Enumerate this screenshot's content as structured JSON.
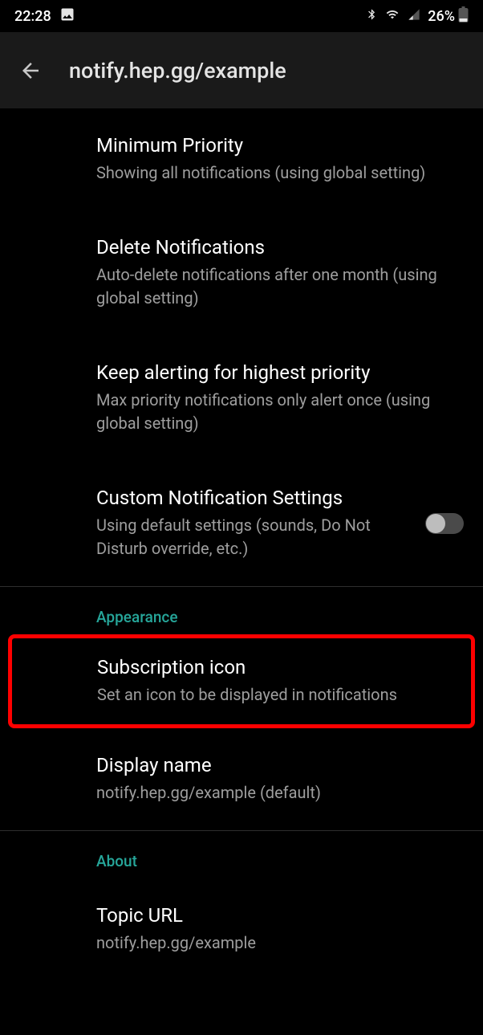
{
  "statusBar": {
    "time": "22:28",
    "batteryPercent": "26%"
  },
  "appBar": {
    "title": "notify.hep.gg/example"
  },
  "settings": {
    "minPriority": {
      "title": "Minimum Priority",
      "subtitle": "Showing all notifications (using global setting)"
    },
    "deleteNotifications": {
      "title": "Delete Notifications",
      "subtitle": "Auto-delete notifications after one month (using global setting)"
    },
    "keepAlerting": {
      "title": "Keep alerting for highest priority",
      "subtitle": "Max priority notifications only alert once (using global setting)"
    },
    "customNotification": {
      "title": "Custom Notification Settings",
      "subtitle": "Using default settings (sounds, Do Not Disturb override, etc.)"
    }
  },
  "sections": {
    "appearance": {
      "header": "Appearance",
      "subscriptionIcon": {
        "title": "Subscription icon",
        "subtitle": "Set an icon to be displayed in notifications"
      },
      "displayName": {
        "title": "Display name",
        "subtitle": "notify.hep.gg/example (default)"
      }
    },
    "about": {
      "header": "About",
      "topicUrl": {
        "title": "Topic URL",
        "subtitle": "notify.hep.gg/example"
      }
    }
  }
}
